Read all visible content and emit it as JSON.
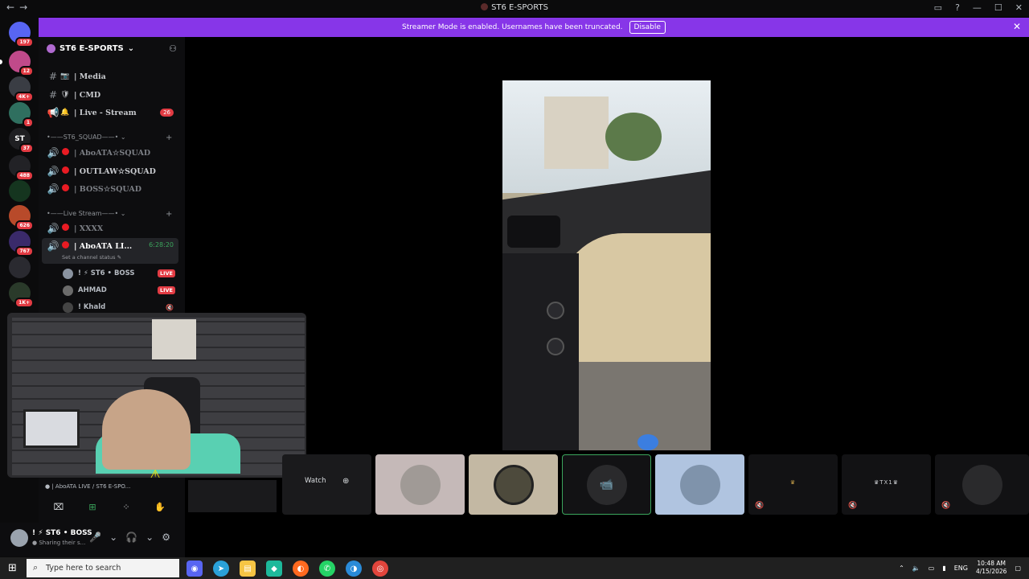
{
  "window": {
    "title": "ST6 E-SPORTS",
    "nav_back": "←",
    "nav_forward": "→",
    "controls": [
      "▭",
      "?",
      "—",
      "☐",
      "✕"
    ]
  },
  "banner": {
    "text": "Streamer Mode is enabled. Usernames have been truncated.",
    "button": "Disable",
    "close": "✕"
  },
  "guilds": [
    {
      "label": "",
      "badge": "197",
      "color": "#5865f2"
    },
    {
      "label": "",
      "badge": "12",
      "color": "#c04a8a"
    },
    {
      "label": "",
      "badge": "4K+",
      "color": "#3a3d44"
    },
    {
      "label": "",
      "badge": "1",
      "color": "#2f6f5f"
    },
    {
      "label": "ST",
      "badge": "37",
      "color": "#1f1f22"
    },
    {
      "label": "",
      "badge": "488",
      "color": "#222226"
    },
    {
      "label": "",
      "badge": "",
      "color": "#15351f"
    },
    {
      "label": "",
      "badge": "626",
      "color": "#b84a2a"
    },
    {
      "label": "",
      "badge": "767",
      "color": "#3a2a6a"
    },
    {
      "label": "",
      "badge": "",
      "color": "#2a2a30"
    },
    {
      "label": "",
      "badge": "1K+",
      "color": "#2a3a2a"
    }
  ],
  "server": {
    "name": "ST6 E-SPORTS",
    "channels_top": [
      {
        "icon": "#",
        "emoji": "📷",
        "name": "| Media"
      },
      {
        "icon": "#",
        "emoji": "🛡",
        "name": "| CMD"
      },
      {
        "icon": "📢",
        "emoji": "🔔",
        "name": "| Live - Stream",
        "count": "26"
      }
    ],
    "category_squad": "•——ST6_SQUAD——•",
    "squad_channels": [
      {
        "name": "| AboATA☆SQUAD"
      },
      {
        "name": "| OUTLAW☆SQUAD"
      },
      {
        "name": "| BOSS☆SQUAD"
      }
    ],
    "category_live": "•——Live Stream——•",
    "live_channels": [
      {
        "name": "| XXXX"
      }
    ],
    "active_channel": {
      "name": "| AboATA LI...",
      "timer": "6:28:20",
      "status": "Set a channel status ✎"
    },
    "voice_users": [
      {
        "name": "! ⚡ ST6 • BOSS",
        "live": "LIVE"
      },
      {
        "name": "AHMAD",
        "live": "LIVE"
      },
      {
        "name": "! Khald",
        "live": ""
      }
    ]
  },
  "voice_panel": {
    "label": "● | AboATA LIVE / ST6 E-SPO...",
    "buttons": [
      "⌧",
      "⊞",
      "⁘",
      "✋"
    ]
  },
  "user_panel": {
    "name": "! ⚡ ST6 • BOSS",
    "status": "● Sharing their s...",
    "controls": [
      "🎤",
      "⌄",
      "🎧",
      "⌄",
      "⚙"
    ]
  },
  "tiles": [
    {
      "type": "watch",
      "label": "Watch",
      "icon": "⊕"
    },
    {
      "type": "avatar",
      "color": "#c5b9b8"
    },
    {
      "type": "avatar",
      "color": "#c3b8a3"
    },
    {
      "type": "camera",
      "color": "#121214",
      "icon": "📹"
    },
    {
      "type": "avatar",
      "color": "#b0c4e0"
    },
    {
      "type": "named",
      "label": "♛",
      "mute": "🔇"
    },
    {
      "type": "named",
      "label": "♛TX1♛",
      "mute": "🔇"
    },
    {
      "type": "avatar",
      "color": "#121214",
      "mute": "🔇"
    }
  ],
  "taskbar": {
    "search_placeholder": "Type here to search",
    "apps": [
      {
        "name": "discord",
        "color": "#5865f2"
      },
      {
        "name": "telegram",
        "color": "#2aa1d9"
      },
      {
        "name": "files",
        "color": "#f6c544"
      },
      {
        "name": "app",
        "color": "#1db99b"
      },
      {
        "name": "firefox",
        "color": "#ff6a1f"
      },
      {
        "name": "whatsapp",
        "color": "#25d366"
      },
      {
        "name": "edge",
        "color": "#2a8bd8"
      },
      {
        "name": "chrome",
        "color": "#e2453c"
      }
    ],
    "lang": "ENG",
    "time": "10:48 AM",
    "date": "4/15/2026"
  }
}
